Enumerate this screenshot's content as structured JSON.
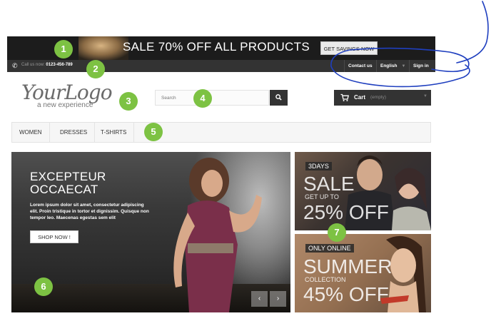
{
  "promo": {
    "sale_text": "SALE 70% OFF ALL PRODUCTS",
    "cta_label": "GET SAVINGS NOW"
  },
  "nav": {
    "phone_prefix": "Call us now: ",
    "phone_number": "0123-456-789",
    "contact_label": "Contact us",
    "language_label": "English",
    "signin_label": "Sign in"
  },
  "logo": {
    "text": "YourLogo",
    "tagline": "a new experience"
  },
  "search": {
    "placeholder": "Search"
  },
  "cart": {
    "label": "Cart",
    "status": "(empty)"
  },
  "menu": {
    "items": [
      "WOMEN",
      "DRESSES",
      "T-SHIRTS"
    ]
  },
  "hero": {
    "title_line1": "EXCEPTEUR",
    "title_line2": "OCCAECAT",
    "body": "Lorem ipsum dolor sit amet, consectetur adipiscing elit. Proin tristique in tortor et dignissim. Quisque non tempor leo. Maecenas egestas sem elit",
    "button_label": "SHOP NOW !",
    "prev_symbol": "‹",
    "next_symbol": "›"
  },
  "banner1": {
    "badge": "3DAYS",
    "headline": "SALE",
    "subline": "GET UP TO",
    "offer": "25% OFF"
  },
  "banner2": {
    "badge": "ONLY ONLINE",
    "headline": "SUMMER",
    "subline": "COLLECTION",
    "offer": "45% OFF"
  },
  "markers": [
    "1",
    "2",
    "3",
    "4",
    "5",
    "6",
    "7"
  ],
  "colors": {
    "marker": "#7dc243",
    "annotation_ink": "#1f3fbf",
    "dark_bar": "#333333"
  }
}
